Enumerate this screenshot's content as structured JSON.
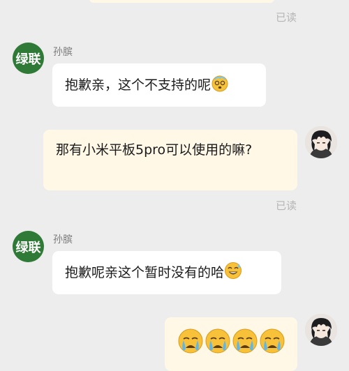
{
  "messages": [
    {
      "status_label": "已读"
    },
    {
      "sender": "孙膑",
      "avatar_text": "绿联",
      "text": "抱歉亲，这个不支持的呢",
      "emoji": "dizzy-face-emoji"
    },
    {
      "text": "那有小米平板5pro可以使用的嘛?",
      "status_label": "已读"
    },
    {
      "sender": "孙膑",
      "avatar_text": "绿联",
      "text": "抱歉呢亲这个暂时没有的哈",
      "emoji": "sweat-smile-emoji"
    },
    {
      "emojis": [
        "crying-face-emoji",
        "crying-face-emoji",
        "crying-face-emoji",
        "crying-face-emoji"
      ]
    }
  ],
  "colors": {
    "background": "#ededed",
    "bubble_self": "#fff8e7",
    "bubble_other": "#ffffff",
    "brand_green": "#2f7a36",
    "read_text": "#b5b5b5"
  }
}
